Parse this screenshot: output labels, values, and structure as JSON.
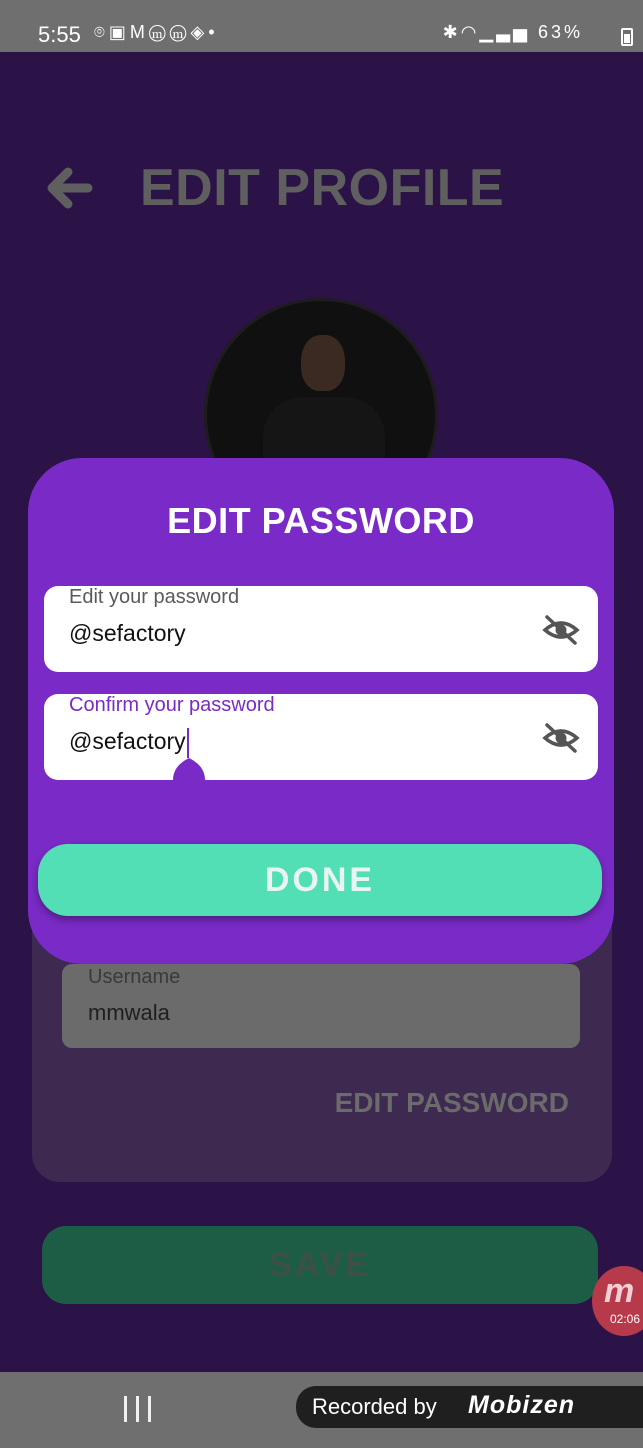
{
  "status_bar": {
    "time": "5:55",
    "left_icons": [
      "location-icon",
      "photo-icon",
      "gmail-icon",
      "m-app-icon",
      "m-app-icon",
      "maps-icon",
      "dot-icon"
    ],
    "right_icons": [
      "bluetooth-icon",
      "wifi-icon",
      "signal-icon"
    ],
    "battery": "63%"
  },
  "header": {
    "title": "EDIT PROFILE",
    "back_icon": "arrow-left-icon"
  },
  "profile_card": {
    "username_label": "Username",
    "username_value": "mmwala",
    "edit_password_link": "EDIT PASSWORD"
  },
  "save_button": {
    "label": "SAVE"
  },
  "dialog": {
    "title": "EDIT PASSWORD",
    "password_field": {
      "label": "Edit your password",
      "value": "@sefactory",
      "toggle_icon": "visibility-off-icon"
    },
    "confirm_field": {
      "label": "Confirm your password",
      "value": "@sefactory",
      "toggle_icon": "visibility-off-icon"
    },
    "done_button": {
      "label": "DONE"
    }
  },
  "recorder": {
    "banner_text": "Recorded by",
    "logo_text": "Mobizen",
    "bubble_time": "02:06"
  },
  "colors": {
    "background": "#2b1247",
    "dialog": "#7a2bc7",
    "done_button": "#52dfb6",
    "save_button": "#1e5d45"
  }
}
